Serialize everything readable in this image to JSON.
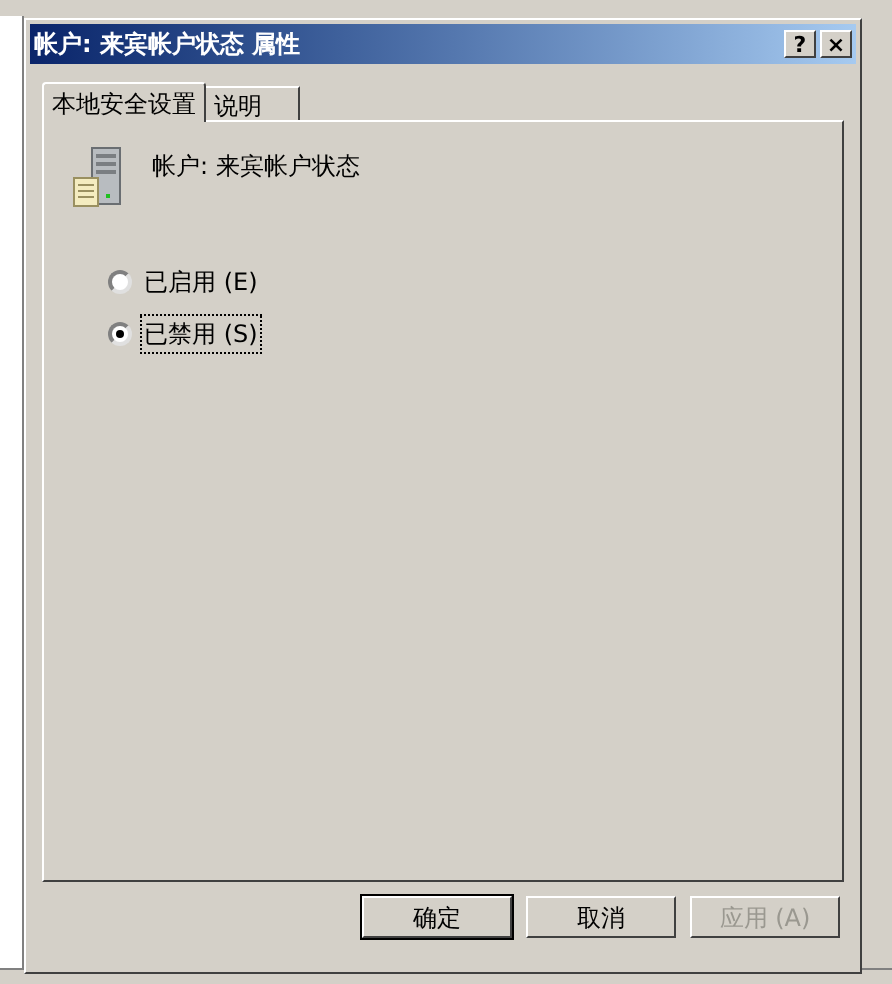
{
  "window": {
    "title": "帐户: 来宾帐户状态 属性"
  },
  "title_buttons": [
    {
      "label": "?"
    },
    {
      "label": "×"
    }
  ],
  "tabs": [
    {
      "label": "本地安全设置",
      "selected": true
    },
    {
      "label": "说明",
      "selected": false
    }
  ],
  "policy": {
    "name": "帐户: 来宾帐户状态"
  },
  "options": [
    {
      "label": "已启用 (E)",
      "selected": false
    },
    {
      "label": "已禁用 (S)",
      "selected": true
    }
  ],
  "buttons": [
    {
      "label": "确定",
      "disabled": false,
      "default": true
    },
    {
      "label": "取消",
      "disabled": false,
      "default": false
    },
    {
      "label": "应用 (A)",
      "disabled": true,
      "default": false
    }
  ]
}
